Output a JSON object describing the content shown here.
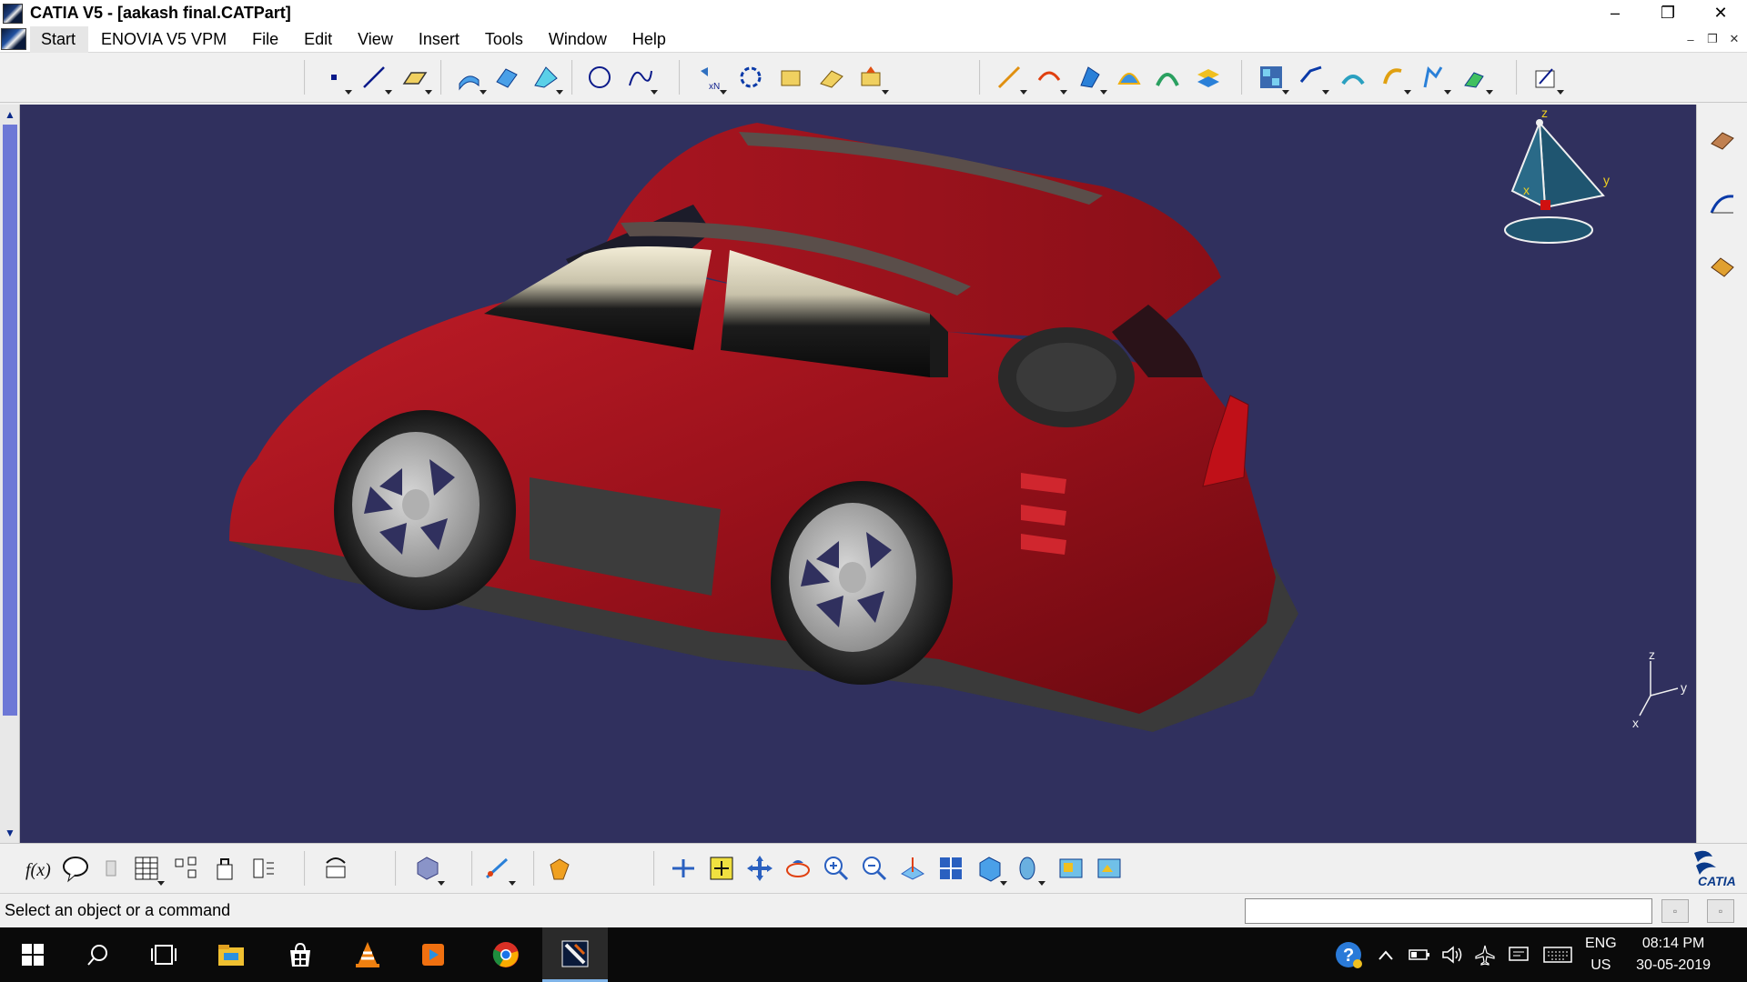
{
  "window": {
    "title": "CATIA V5 - [aakash final.CATPart]",
    "controls": {
      "minimize": "–",
      "restore": "❐",
      "close": "✕"
    }
  },
  "menu": {
    "items": [
      {
        "label": "Start"
      },
      {
        "label": "ENOVIA V5 VPM"
      },
      {
        "label": "File"
      },
      {
        "label": "Edit"
      },
      {
        "label": "View"
      },
      {
        "label": "Insert"
      },
      {
        "label": "Tools"
      },
      {
        "label": "Window"
      },
      {
        "label": "Help"
      }
    ],
    "doc_controls": {
      "minimize": "–",
      "restore": "❐",
      "close": "✕"
    }
  },
  "viewport": {
    "background": "#30305e",
    "car_body_color": "#a8151f",
    "compass_labels": {
      "z": "z",
      "y": "y",
      "x": "x"
    },
    "axis_labels": {
      "z": "z",
      "y": "y",
      "x": "x"
    }
  },
  "branding": {
    "logo_text": "CATIA"
  },
  "status": {
    "message": "Select an object or a command",
    "command_input": ""
  },
  "taskbar": {
    "apps": [
      "windows-start",
      "search",
      "task-view",
      "file-explorer",
      "store",
      "vlc",
      "media-player",
      "chrome",
      "catia"
    ],
    "language_top": "ENG",
    "language_bottom": "US",
    "time": "08:14 PM",
    "date": "30-05-2019"
  }
}
